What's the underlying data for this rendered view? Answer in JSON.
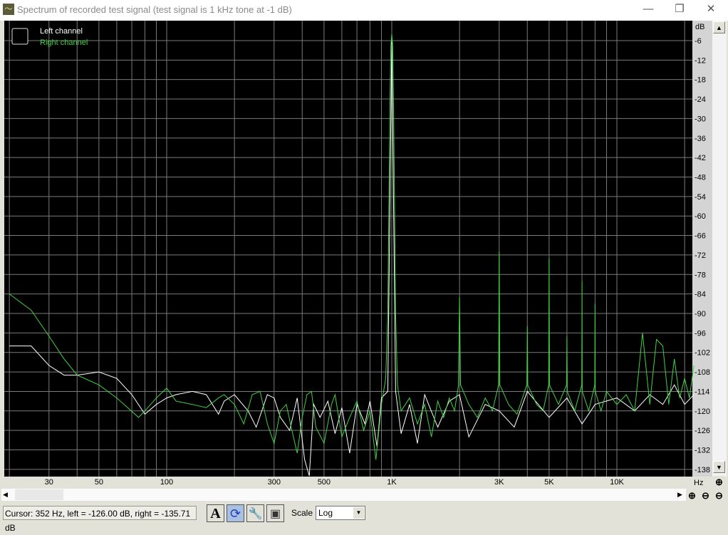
{
  "window": {
    "title": "Spectrum of recorded test signal (test signal is 1 kHz tone at -1 dB)",
    "minimize": "—",
    "restore": "❐",
    "close": "✕"
  },
  "legend": {
    "left": "Left channel",
    "right": "Right channel"
  },
  "status": {
    "cursor": "Cursor:  352 Hz,  left = -126.00 dB,  right = -135.71 dB"
  },
  "toolbar": {
    "font_button": "A",
    "scale_label": "Scale",
    "scale_value": "Log"
  },
  "colors": {
    "background": "#000000",
    "grid": "#7a7a7a",
    "left": "#ffffff",
    "right": "#3fd23f"
  },
  "chart_data": {
    "type": "line",
    "xscale": "log",
    "xlim": [
      19,
      22000
    ],
    "ylim": [
      -140,
      0
    ],
    "grid": true,
    "legend": "top-left",
    "xlabel": "Hz",
    "ylabel": "dB",
    "x_ticks": [
      {
        "v": 30,
        "label": "30"
      },
      {
        "v": 50,
        "label": "50"
      },
      {
        "v": 100,
        "label": "100"
      },
      {
        "v": 300,
        "label": "300"
      },
      {
        "v": 500,
        "label": "500"
      },
      {
        "v": 1000,
        "label": "1K"
      },
      {
        "v": 3000,
        "label": "3K"
      },
      {
        "v": 5000,
        "label": "5K"
      },
      {
        "v": 10000,
        "label": "10K"
      }
    ],
    "y_ticks": [
      -6,
      -12,
      -18,
      -24,
      -30,
      -36,
      -42,
      -48,
      -54,
      -60,
      -66,
      -72,
      -78,
      -84,
      -90,
      -96,
      -102,
      -108,
      -114,
      -120,
      -126,
      -132,
      -138
    ],
    "series": [
      {
        "name": "Left channel",
        "points": [
          [
            20,
            -100
          ],
          [
            25,
            -100
          ],
          [
            30,
            -106
          ],
          [
            35,
            -109
          ],
          [
            40,
            -109
          ],
          [
            50,
            -108
          ],
          [
            60,
            -110
          ],
          [
            70,
            -115
          ],
          [
            80,
            -121
          ],
          [
            90,
            -118
          ],
          [
            100,
            -116
          ],
          [
            110,
            -115
          ],
          [
            130,
            -114
          ],
          [
            150,
            -115
          ],
          [
            170,
            -121
          ],
          [
            180,
            -117
          ],
          [
            200,
            -115
          ],
          [
            230,
            -120
          ],
          [
            250,
            -125
          ],
          [
            280,
            -115
          ],
          [
            300,
            -116
          ],
          [
            320,
            -122
          ],
          [
            352,
            -126
          ],
          [
            380,
            -116
          ],
          [
            410,
            -135
          ],
          [
            430,
            -140
          ],
          [
            450,
            -118
          ],
          [
            480,
            -122
          ],
          [
            520,
            -117
          ],
          [
            560,
            -127
          ],
          [
            600,
            -119
          ],
          [
            650,
            -133
          ],
          [
            700,
            -118
          ],
          [
            760,
            -124
          ],
          [
            800,
            -117
          ],
          [
            860,
            -131
          ],
          [
            900,
            -116
          ],
          [
            960,
            -114
          ],
          [
            980,
            -60
          ],
          [
            1000,
            -6
          ],
          [
            1020,
            -60
          ],
          [
            1040,
            -114
          ],
          [
            1100,
            -127
          ],
          [
            1200,
            -118
          ],
          [
            1300,
            -130
          ],
          [
            1400,
            -115
          ],
          [
            1600,
            -125
          ],
          [
            1800,
            -117
          ],
          [
            2000,
            -115
          ],
          [
            2200,
            -128
          ],
          [
            2600,
            -118
          ],
          [
            3000,
            -120
          ],
          [
            3500,
            -125
          ],
          [
            4000,
            -114
          ],
          [
            5000,
            -122
          ],
          [
            6000,
            -116
          ],
          [
            7000,
            -124
          ],
          [
            8000,
            -118
          ],
          [
            10000,
            -116
          ],
          [
            12000,
            -120
          ],
          [
            14000,
            -115
          ],
          [
            16000,
            -118
          ],
          [
            18000,
            -112
          ],
          [
            20000,
            -118
          ],
          [
            22000,
            -115
          ]
        ]
      },
      {
        "name": "Right channel",
        "points": [
          [
            20,
            -84
          ],
          [
            25,
            -89
          ],
          [
            30,
            -97
          ],
          [
            35,
            -104
          ],
          [
            40,
            -109
          ],
          [
            50,
            -112
          ],
          [
            60,
            -116
          ],
          [
            75,
            -122
          ],
          [
            80,
            -120
          ],
          [
            90,
            -116
          ],
          [
            100,
            -113
          ],
          [
            110,
            -117
          ],
          [
            130,
            -118
          ],
          [
            150,
            -119
          ],
          [
            170,
            -116
          ],
          [
            180,
            -115
          ],
          [
            200,
            -118
          ],
          [
            220,
            -124
          ],
          [
            240,
            -115
          ],
          [
            260,
            -114
          ],
          [
            280,
            -124
          ],
          [
            300,
            -130
          ],
          [
            320,
            -120
          ],
          [
            340,
            -118
          ],
          [
            360,
            -126
          ],
          [
            380,
            -133
          ],
          [
            400,
            -122
          ],
          [
            420,
            -115
          ],
          [
            440,
            -114
          ],
          [
            460,
            -125
          ],
          [
            500,
            -130
          ],
          [
            540,
            -118
          ],
          [
            560,
            -115
          ],
          [
            600,
            -128
          ],
          [
            650,
            -122
          ],
          [
            700,
            -117
          ],
          [
            750,
            -126
          ],
          [
            800,
            -120
          ],
          [
            850,
            -135
          ],
          [
            900,
            -118
          ],
          [
            940,
            -110
          ],
          [
            960,
            -90
          ],
          [
            980,
            -30
          ],
          [
            990,
            -8
          ],
          [
            1000,
            -4
          ],
          [
            1010,
            -8
          ],
          [
            1020,
            -30
          ],
          [
            1040,
            -90
          ],
          [
            1060,
            -112
          ],
          [
            1100,
            -120
          ],
          [
            1200,
            -116
          ],
          [
            1300,
            -124
          ],
          [
            1400,
            -118
          ],
          [
            1500,
            -128
          ],
          [
            1600,
            -117
          ],
          [
            1700,
            -122
          ],
          [
            1800,
            -116
          ],
          [
            1900,
            -120
          ],
          [
            1980,
            -112
          ],
          [
            2000,
            -85
          ],
          [
            2020,
            -112
          ],
          [
            2200,
            -118
          ],
          [
            2400,
            -122
          ],
          [
            2600,
            -116
          ],
          [
            2800,
            -120
          ],
          [
            2980,
            -112
          ],
          [
            3000,
            -71
          ],
          [
            3020,
            -112
          ],
          [
            3300,
            -118
          ],
          [
            3600,
            -121
          ],
          [
            3980,
            -112
          ],
          [
            4000,
            -94
          ],
          [
            4020,
            -112
          ],
          [
            4400,
            -118
          ],
          [
            4700,
            -120
          ],
          [
            4980,
            -112
          ],
          [
            5000,
            -73
          ],
          [
            5020,
            -112
          ],
          [
            5500,
            -118
          ],
          [
            5980,
            -112
          ],
          [
            6000,
            -97
          ],
          [
            6020,
            -114
          ],
          [
            6500,
            -120
          ],
          [
            6980,
            -112
          ],
          [
            7000,
            -80
          ],
          [
            7020,
            -114
          ],
          [
            7500,
            -120
          ],
          [
            7980,
            -112
          ],
          [
            8000,
            -87
          ],
          [
            8020,
            -114
          ],
          [
            8500,
            -120
          ],
          [
            9000,
            -114
          ],
          [
            10000,
            -118
          ],
          [
            11000,
            -115
          ],
          [
            12000,
            -120
          ],
          [
            13000,
            -96
          ],
          [
            14000,
            -118
          ],
          [
            15000,
            -98
          ],
          [
            16000,
            -100
          ],
          [
            17000,
            -118
          ],
          [
            18000,
            -104
          ],
          [
            19000,
            -116
          ],
          [
            20000,
            -110
          ],
          [
            21000,
            -116
          ],
          [
            22000,
            -106
          ]
        ]
      }
    ]
  }
}
